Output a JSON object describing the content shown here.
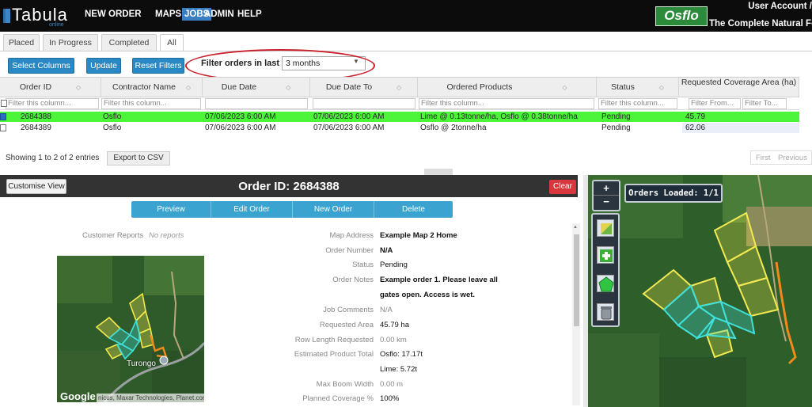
{
  "app": {
    "logo": "Tabula",
    "logo_sub": "online"
  },
  "nav": {
    "items": [
      "NEW ORDER",
      "MAPS",
      "JOBS",
      "ADMIN",
      "HELP"
    ],
    "active": "JOBS"
  },
  "brand": {
    "name": "Osflo",
    "tagline": "The Complete Natural Fer",
    "account": "User Account /"
  },
  "tabs": [
    "Placed",
    "In Progress",
    "Completed",
    "All"
  ],
  "toolbar": {
    "select_columns": "Select Columns",
    "update": "Update",
    "reset_filters": "Reset Filters",
    "filter_label": "Filter orders in last",
    "filter_value": "3 months"
  },
  "table": {
    "columns": [
      "Order ID",
      "Contractor Name",
      "Due Date",
      "Due Date To",
      "Ordered Products",
      "Status",
      "Requested Coverage Area (ha)"
    ],
    "filter_placeholder": "Filter this column...",
    "filter_from": "Filter From...",
    "filter_to": "Filter To...",
    "rows": [
      {
        "order_id": "2684388",
        "contractor": "Osflo",
        "due": "07/06/2023 6:00 AM",
        "due_to": "07/06/2023 6:00 AM",
        "products": "Lime @ 0.13tonne/ha, Osflo @ 0.38tonne/ha",
        "status": "Pending",
        "area": "45.79",
        "selected": true
      },
      {
        "order_id": "2684389",
        "contractor": "Osflo",
        "due": "07/06/2023 6:00 AM",
        "due_to": "07/06/2023 6:00 AM",
        "products": "Osflo @ 2tonne/ha",
        "status": "Pending",
        "area": "62.06",
        "selected": false
      }
    ],
    "showing": "Showing 1 to 2 of 2 entries",
    "export": "Export to CSV",
    "pager": [
      "First",
      "Previous"
    ]
  },
  "order": {
    "customise": "Customise View",
    "title": "Order ID: 2684388",
    "clear": "Clear",
    "actions": [
      "Preview",
      "Edit Order",
      "New Order",
      "Delete"
    ],
    "customer_reports_label": "Customer Reports",
    "customer_reports_value": "No reports",
    "details": [
      {
        "label": "Map Address",
        "value": "Example Map 2 Home",
        "bold": true
      },
      {
        "label": "Order Number",
        "value": "N/A",
        "bold": true
      },
      {
        "label": "Status",
        "value": "Pending",
        "bold": false
      },
      {
        "label": "Order Notes",
        "value": "Example order 1. Please leave all",
        "bold": true
      },
      {
        "label": "",
        "value": "gates open. Access is wet.",
        "bold": true
      },
      {
        "label": "Job Comments",
        "value": "N/A",
        "bold": false
      },
      {
        "label": "Requested Area",
        "value": "45.79 ha",
        "bold": false
      },
      {
        "label": "Row Length Requested",
        "value": "0.00 km",
        "bold": false
      },
      {
        "label": "Estimated Product Total",
        "value": "Osflo: 17.17t",
        "bold": false
      },
      {
        "label": "",
        "value": "Lime: 5.72t",
        "bold": false
      },
      {
        "label": "Max Boom Width",
        "value": "0.00 m",
        "bold": false
      },
      {
        "label": "Planned Coverage %",
        "value": "100%",
        "bold": false
      }
    ],
    "minimap": {
      "place": "Turongo",
      "attribution": "Google",
      "credits": "nicus, Maxar Technologies, Planet.com"
    }
  },
  "map": {
    "orders_loaded": "Orders Loaded: 1/1",
    "zoom_in": "+",
    "zoom_out": "−"
  },
  "colors": {
    "nav_bg": "#0c0c0c",
    "accent": "#2a89c4",
    "selected_row": "#4cf53a",
    "oval": "#c8202a",
    "field_yellow": "#e8e04a",
    "field_cyan": "#3fd6d0",
    "field_orange": "#f08a1c"
  }
}
